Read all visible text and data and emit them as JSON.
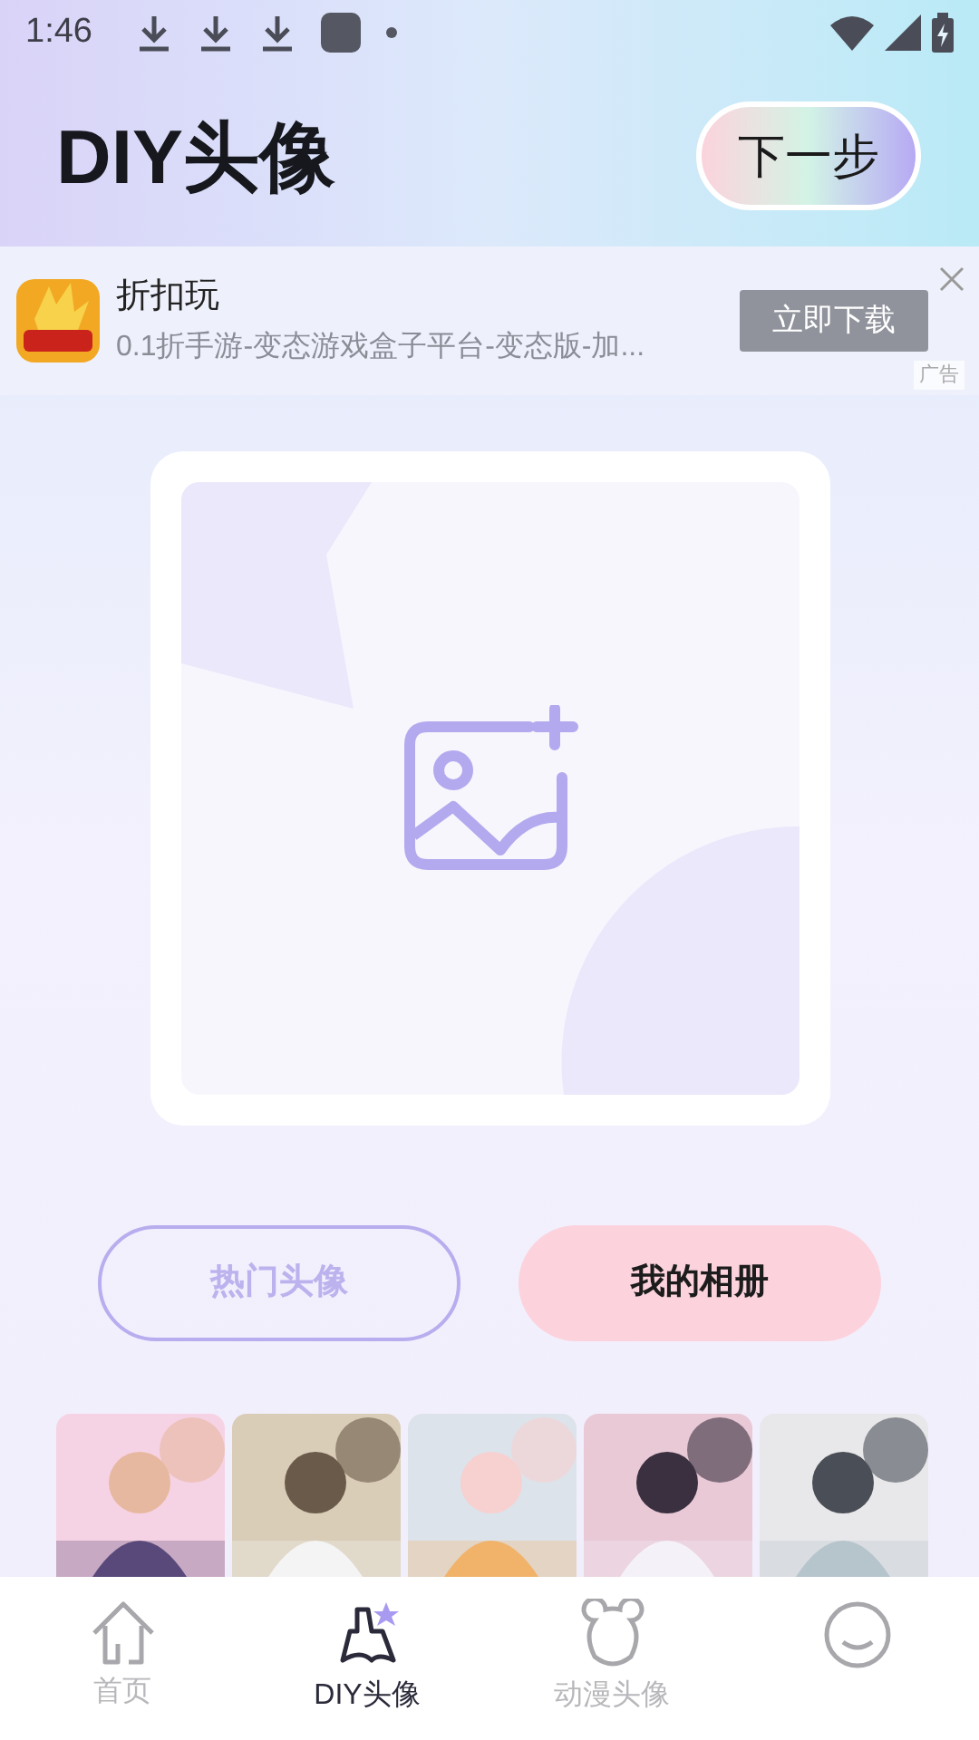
{
  "status_bar": {
    "time": "1:46"
  },
  "header": {
    "title": "DIY头像",
    "next_button": "下一步"
  },
  "ad": {
    "app_name": "折扣玩",
    "description": "0.1折手游-变态游戏盒子平台-变态版-加...",
    "download_button": "立即下载",
    "ad_label": "广告"
  },
  "upload": {
    "kind": "image-placeholder"
  },
  "actions": [
    {
      "label": "热门头像",
      "selected": false
    },
    {
      "label": "我的相册",
      "selected": true
    }
  ],
  "bottom_nav": [
    {
      "label": "首页",
      "selected": false
    },
    {
      "label": "DIY头像",
      "selected": true
    },
    {
      "label": "动漫头像",
      "selected": false
    },
    {
      "selected": false
    }
  ]
}
